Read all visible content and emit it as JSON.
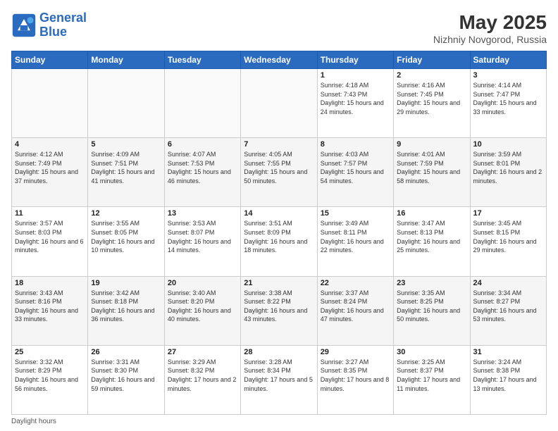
{
  "logo": {
    "line1": "General",
    "line2": "Blue"
  },
  "title": "May 2025",
  "location": "Nizhniy Novgorod, Russia",
  "days_of_week": [
    "Sunday",
    "Monday",
    "Tuesday",
    "Wednesday",
    "Thursday",
    "Friday",
    "Saturday"
  ],
  "footer": "Daylight hours",
  "weeks": [
    [
      {
        "num": "",
        "sunrise": "",
        "sunset": "",
        "daylight": ""
      },
      {
        "num": "",
        "sunrise": "",
        "sunset": "",
        "daylight": ""
      },
      {
        "num": "",
        "sunrise": "",
        "sunset": "",
        "daylight": ""
      },
      {
        "num": "",
        "sunrise": "",
        "sunset": "",
        "daylight": ""
      },
      {
        "num": "1",
        "sunrise": "Sunrise: 4:18 AM",
        "sunset": "Sunset: 7:43 PM",
        "daylight": "Daylight: 15 hours and 24 minutes."
      },
      {
        "num": "2",
        "sunrise": "Sunrise: 4:16 AM",
        "sunset": "Sunset: 7:45 PM",
        "daylight": "Daylight: 15 hours and 29 minutes."
      },
      {
        "num": "3",
        "sunrise": "Sunrise: 4:14 AM",
        "sunset": "Sunset: 7:47 PM",
        "daylight": "Daylight: 15 hours and 33 minutes."
      }
    ],
    [
      {
        "num": "4",
        "sunrise": "Sunrise: 4:12 AM",
        "sunset": "Sunset: 7:49 PM",
        "daylight": "Daylight: 15 hours and 37 minutes."
      },
      {
        "num": "5",
        "sunrise": "Sunrise: 4:09 AM",
        "sunset": "Sunset: 7:51 PM",
        "daylight": "Daylight: 15 hours and 41 minutes."
      },
      {
        "num": "6",
        "sunrise": "Sunrise: 4:07 AM",
        "sunset": "Sunset: 7:53 PM",
        "daylight": "Daylight: 15 hours and 46 minutes."
      },
      {
        "num": "7",
        "sunrise": "Sunrise: 4:05 AM",
        "sunset": "Sunset: 7:55 PM",
        "daylight": "Daylight: 15 hours and 50 minutes."
      },
      {
        "num": "8",
        "sunrise": "Sunrise: 4:03 AM",
        "sunset": "Sunset: 7:57 PM",
        "daylight": "Daylight: 15 hours and 54 minutes."
      },
      {
        "num": "9",
        "sunrise": "Sunrise: 4:01 AM",
        "sunset": "Sunset: 7:59 PM",
        "daylight": "Daylight: 15 hours and 58 minutes."
      },
      {
        "num": "10",
        "sunrise": "Sunrise: 3:59 AM",
        "sunset": "Sunset: 8:01 PM",
        "daylight": "Daylight: 16 hours and 2 minutes."
      }
    ],
    [
      {
        "num": "11",
        "sunrise": "Sunrise: 3:57 AM",
        "sunset": "Sunset: 8:03 PM",
        "daylight": "Daylight: 16 hours and 6 minutes."
      },
      {
        "num": "12",
        "sunrise": "Sunrise: 3:55 AM",
        "sunset": "Sunset: 8:05 PM",
        "daylight": "Daylight: 16 hours and 10 minutes."
      },
      {
        "num": "13",
        "sunrise": "Sunrise: 3:53 AM",
        "sunset": "Sunset: 8:07 PM",
        "daylight": "Daylight: 16 hours and 14 minutes."
      },
      {
        "num": "14",
        "sunrise": "Sunrise: 3:51 AM",
        "sunset": "Sunset: 8:09 PM",
        "daylight": "Daylight: 16 hours and 18 minutes."
      },
      {
        "num": "15",
        "sunrise": "Sunrise: 3:49 AM",
        "sunset": "Sunset: 8:11 PM",
        "daylight": "Daylight: 16 hours and 22 minutes."
      },
      {
        "num": "16",
        "sunrise": "Sunrise: 3:47 AM",
        "sunset": "Sunset: 8:13 PM",
        "daylight": "Daylight: 16 hours and 25 minutes."
      },
      {
        "num": "17",
        "sunrise": "Sunrise: 3:45 AM",
        "sunset": "Sunset: 8:15 PM",
        "daylight": "Daylight: 16 hours and 29 minutes."
      }
    ],
    [
      {
        "num": "18",
        "sunrise": "Sunrise: 3:43 AM",
        "sunset": "Sunset: 8:16 PM",
        "daylight": "Daylight: 16 hours and 33 minutes."
      },
      {
        "num": "19",
        "sunrise": "Sunrise: 3:42 AM",
        "sunset": "Sunset: 8:18 PM",
        "daylight": "Daylight: 16 hours and 36 minutes."
      },
      {
        "num": "20",
        "sunrise": "Sunrise: 3:40 AM",
        "sunset": "Sunset: 8:20 PM",
        "daylight": "Daylight: 16 hours and 40 minutes."
      },
      {
        "num": "21",
        "sunrise": "Sunrise: 3:38 AM",
        "sunset": "Sunset: 8:22 PM",
        "daylight": "Daylight: 16 hours and 43 minutes."
      },
      {
        "num": "22",
        "sunrise": "Sunrise: 3:37 AM",
        "sunset": "Sunset: 8:24 PM",
        "daylight": "Daylight: 16 hours and 47 minutes."
      },
      {
        "num": "23",
        "sunrise": "Sunrise: 3:35 AM",
        "sunset": "Sunset: 8:25 PM",
        "daylight": "Daylight: 16 hours and 50 minutes."
      },
      {
        "num": "24",
        "sunrise": "Sunrise: 3:34 AM",
        "sunset": "Sunset: 8:27 PM",
        "daylight": "Daylight: 16 hours and 53 minutes."
      }
    ],
    [
      {
        "num": "25",
        "sunrise": "Sunrise: 3:32 AM",
        "sunset": "Sunset: 8:29 PM",
        "daylight": "Daylight: 16 hours and 56 minutes."
      },
      {
        "num": "26",
        "sunrise": "Sunrise: 3:31 AM",
        "sunset": "Sunset: 8:30 PM",
        "daylight": "Daylight: 16 hours and 59 minutes."
      },
      {
        "num": "27",
        "sunrise": "Sunrise: 3:29 AM",
        "sunset": "Sunset: 8:32 PM",
        "daylight": "Daylight: 17 hours and 2 minutes."
      },
      {
        "num": "28",
        "sunrise": "Sunrise: 3:28 AM",
        "sunset": "Sunset: 8:34 PM",
        "daylight": "Daylight: 17 hours and 5 minutes."
      },
      {
        "num": "29",
        "sunrise": "Sunrise: 3:27 AM",
        "sunset": "Sunset: 8:35 PM",
        "daylight": "Daylight: 17 hours and 8 minutes."
      },
      {
        "num": "30",
        "sunrise": "Sunrise: 3:25 AM",
        "sunset": "Sunset: 8:37 PM",
        "daylight": "Daylight: 17 hours and 11 minutes."
      },
      {
        "num": "31",
        "sunrise": "Sunrise: 3:24 AM",
        "sunset": "Sunset: 8:38 PM",
        "daylight": "Daylight: 17 hours and 13 minutes."
      }
    ]
  ]
}
